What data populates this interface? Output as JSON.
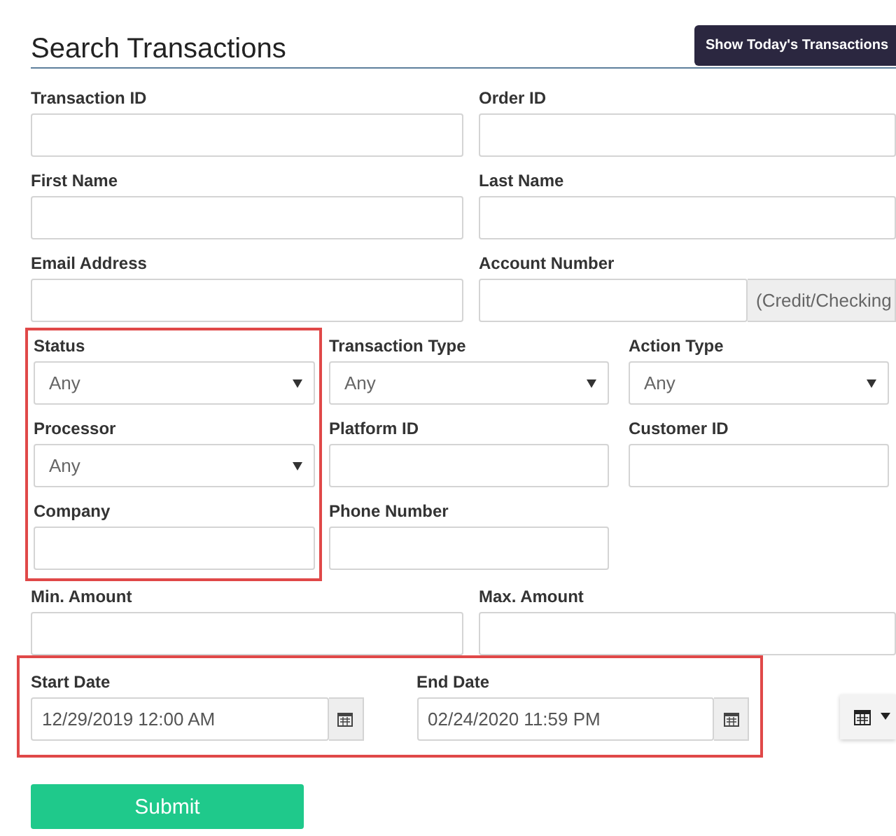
{
  "title": "Search Transactions",
  "today_button": "Show Today's Transactions",
  "pair_rows": [
    [
      {
        "label": "Transaction ID",
        "kind": "text"
      },
      {
        "label": "Order ID",
        "kind": "text"
      }
    ],
    [
      {
        "label": "First Name",
        "kind": "text"
      },
      {
        "label": "Last Name",
        "kind": "text"
      }
    ],
    [
      {
        "label": "Email Address",
        "kind": "text"
      },
      {
        "label": "Account Number",
        "kind": "addon",
        "addon": "(Credit/Checking"
      }
    ]
  ],
  "columns": [
    {
      "highlighted": true,
      "fields": [
        {
          "label": "Status",
          "kind": "select",
          "value": "Any"
        },
        {
          "label": "Processor",
          "kind": "select",
          "value": "Any"
        },
        {
          "label": "Company",
          "kind": "text"
        }
      ]
    },
    {
      "highlighted": false,
      "fields": [
        {
          "label": "Transaction Type",
          "kind": "select",
          "value": "Any"
        },
        {
          "label": "Platform ID",
          "kind": "text"
        },
        {
          "label": "Phone Number",
          "kind": "text"
        }
      ]
    },
    {
      "highlighted": false,
      "fields": [
        {
          "label": "Action Type",
          "kind": "select",
          "value": "Any"
        },
        {
          "label": "Customer ID",
          "kind": "text"
        }
      ]
    }
  ],
  "amount_row": [
    {
      "label": "Min. Amount",
      "kind": "text"
    },
    {
      "label": "Max. Amount",
      "kind": "text"
    }
  ],
  "dates": {
    "highlighted": true,
    "fields": [
      {
        "label": "Start Date",
        "kind": "date",
        "value": "12/29/2019 12:00 AM"
      },
      {
        "label": "End Date",
        "kind": "date",
        "value": "02/24/2020 11:59 PM"
      }
    ]
  },
  "submit": "Submit"
}
